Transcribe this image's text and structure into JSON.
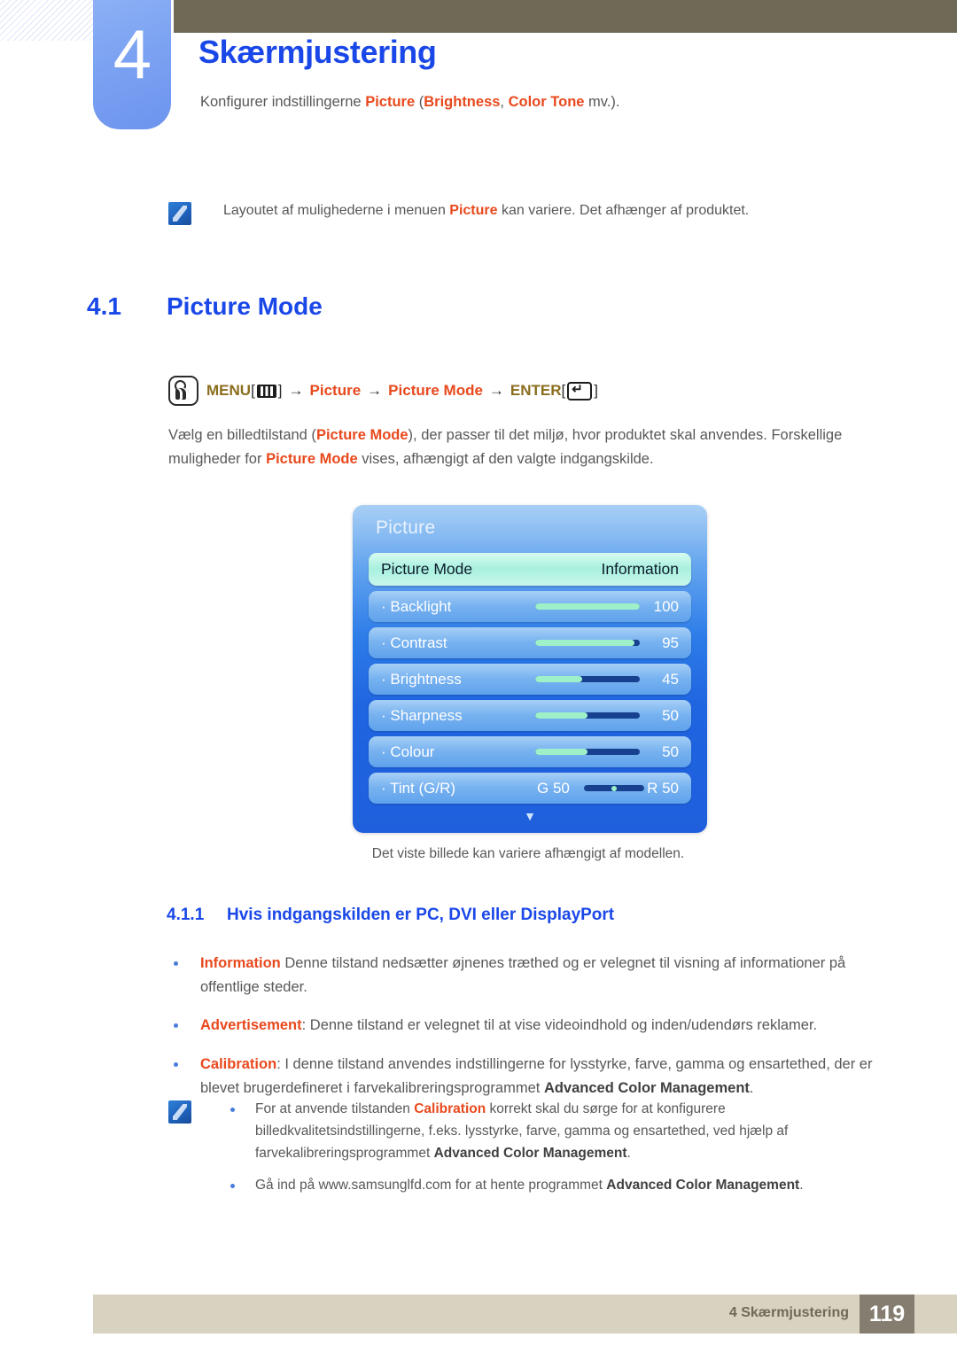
{
  "chapter": {
    "number": "4",
    "title": "Skærmjustering",
    "intro_before": "Konfigurer indstillingerne ",
    "intro_kw1": "Picture",
    "intro_mid1": " (",
    "intro_kw2": "Brightness",
    "intro_mid2": ", ",
    "intro_kw3": "Color Tone",
    "intro_after": " mv.)."
  },
  "note_top": {
    "icon": "memo-icon",
    "before": "Layoutet af mulighederne i menuen ",
    "keyword": "Picture",
    "after": " kan variere. Det afhænger af produktet."
  },
  "section": {
    "number": "4.1",
    "title": "Picture Mode"
  },
  "menu_path": {
    "touch_icon": "touch-button-icon",
    "menu_label": "MENU",
    "menu_bracket_open": "[",
    "menu_icon": "menu-button-icon",
    "menu_bracket_close": "]",
    "arrow": "→",
    "step_picture": "Picture",
    "step_picture_mode": "Picture Mode",
    "enter_label": "ENTER",
    "enter_bracket_open": "[",
    "enter_icon": "enter-button-icon",
    "enter_bracket_close": "]"
  },
  "paragraph": {
    "p1": "Vælg en billedtilstand (",
    "p1_kw": "Picture Mode",
    "p2": "), der passer til det miljø, hvor produktet skal anvendes. Forskellige muligheder for ",
    "p2_kw": "Picture Mode",
    "p3": " vises, afhængigt af den valgte indgangskilde."
  },
  "osd": {
    "title": "Picture",
    "rows": [
      {
        "label": "Picture Mode",
        "value": "Information",
        "type": "select",
        "selected": true
      },
      {
        "label": "· Backlight",
        "value": "100",
        "type": "slider",
        "fill_pct": 100,
        "selected": false
      },
      {
        "label": "· Contrast",
        "value": "95",
        "type": "slider",
        "fill_pct": 95,
        "selected": false
      },
      {
        "label": "· Brightness",
        "value": "45",
        "type": "slider",
        "fill_pct": 45,
        "selected": false
      },
      {
        "label": "· Sharpness",
        "value": "50",
        "type": "slider",
        "fill_pct": 50,
        "selected": false
      },
      {
        "label": "· Colour",
        "value": "50",
        "type": "slider",
        "fill_pct": 50,
        "selected": false
      }
    ],
    "tint": {
      "label": "· Tint (G/R)",
      "green_value": "G 50",
      "red_value": "R 50"
    },
    "scroll_caret": "▼"
  },
  "osd_caption": "Det viste billede kan variere afhængigt af modellen.",
  "subsection": {
    "number": "4.1.1",
    "title": "Hvis indgangskilden er PC, DVI eller DisplayPort"
  },
  "bullets": [
    {
      "keyword": "Information",
      "text": " Denne tilstand nedsætter øjnenes træthed og er velegnet til visning af informationer på offentlige steder."
    },
    {
      "keyword": "Advertisement",
      "text": ": Denne tilstand er velegnet til at vise videoindhold og inden/udendørs reklamer."
    },
    {
      "keyword": "Calibration",
      "text": ": I denne tilstand anvendes indstillingerne for lysstyrke, farve, gamma og ensartethed, der er blevet brugerdefineret i farvekalibreringsprogrammet ",
      "bold_tail": "Advanced Color Management",
      "tail": "."
    }
  ],
  "note_bottom": {
    "icon": "memo-icon",
    "items": [
      {
        "a": "For at anvende tilstanden ",
        "keyword": "Calibration",
        "b": " korrekt skal du sørge for at konfigurere billedkvalitetsindstillingerne, f.eks. lysstyrke, farve, gamma og ensartethed, ved hjælp af farvekalibreringsprogrammet ",
        "bold": "Advanced Color Management",
        "c": "."
      },
      {
        "a": "Gå ind på www.samsunglfd.com for at hente programmet ",
        "bold": "Advanced Color Management",
        "c": "."
      }
    ]
  },
  "footer": {
    "text": "4 Skærmjustering",
    "page": "119"
  },
  "colors": {
    "heading_blue": "#1a47e8",
    "keyword_orange": "#e8491d",
    "keyword_gold": "#8a6d1d",
    "olive_bar": "#6e6a55",
    "tab_blue": "#7ba2f2",
    "footer_beige": "#d8d3c0",
    "footer_page_box": "#857d6f",
    "osd_blue": "#1f64e0",
    "osd_highlight": "#a8f0df",
    "slider_fill": "#9df0c8"
  }
}
